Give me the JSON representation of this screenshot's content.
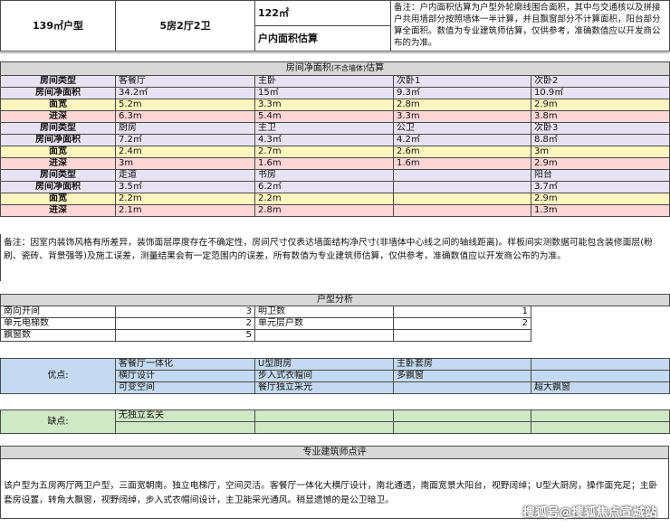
{
  "header": {
    "unit_type": "139㎡户型",
    "layout": "5房2厅2卫",
    "area": "122㎡",
    "area_label": "户内面积估算",
    "note": "备注：户内面积估算为户型外轮廓线围合面积，其中与交通核以及拼接户共用墙部分按照墙体一半计算，并且飘窗部分不计算面积，阳台部分算全面积。数值为专业建筑师估算，仅供参考，准确数值应以开发商公布的为准。"
  },
  "net_area": {
    "title": "房间净面积",
    "title_small": "(不含墙体)",
    "title_suffix": "估算",
    "labels": [
      "房间类型",
      "房间净面积",
      "面宽",
      "进深"
    ],
    "groups": [
      {
        "rooms": [
          "客餐厅",
          "主卧",
          "次卧1",
          "次卧2"
        ],
        "area": [
          "34.2㎡",
          "15㎡",
          "9.3㎡",
          "10.9㎡"
        ],
        "width": [
          "5.2m",
          "3.3m",
          "2.8m",
          "2.9m"
        ],
        "depth": [
          "6.3m",
          "5.4m",
          "3.3m",
          "3.8m"
        ]
      },
      {
        "rooms": [
          "厨房",
          "主卫",
          "公卫",
          "次卧3"
        ],
        "area": [
          "7.2㎡",
          "4.3㎡",
          "4.2㎡",
          "8.8㎡"
        ],
        "width": [
          "2.4m",
          "2.7m",
          "2.6m",
          "3m"
        ],
        "depth": [
          "3m",
          "1.6m",
          "1.6m",
          "2.9m"
        ]
      },
      {
        "rooms": [
          "走道",
          "书房",
          "",
          "阳台"
        ],
        "area": [
          "3.5㎡",
          "6.2㎡",
          "",
          "3.7㎡"
        ],
        "width": [
          "2.2m",
          "2.2m",
          "",
          "2.9m"
        ],
        "depth": [
          "2.1m",
          "2.8m",
          "",
          "1.3m"
        ]
      }
    ]
  },
  "note1": "备注：因室内装饰风格有所差异，装饰面层厚度存在不确定性，房间尺寸仅表达墙面结构净尺寸(非墙体中心线之间的轴线距离)。样板间实测数据可能包含装修面层(粉刷、瓷砖、背景强等)及施工误差，测量结果会有一定范围内的误差，所有数值为专业建筑师估算，仅供参考，准确数值应以开发商公布的为准。",
  "analysis": {
    "title": "户型分析",
    "rows": [
      {
        "left_label": "南向开间",
        "left_value": "3",
        "right_label": "明卫数",
        "right_value": "1"
      },
      {
        "left_label": "单元电梯数",
        "left_value": "2",
        "right_label": "单元层户数",
        "right_value": "2"
      },
      {
        "left_label": "飘窗数",
        "left_value": "5",
        "right_label": "",
        "right_value": ""
      }
    ]
  },
  "pros": {
    "label": "优点:",
    "rows": [
      [
        "客餐厅一体化",
        "U型厨房",
        "主卧套房",
        ""
      ],
      [
        "横厅设计",
        "步入式衣帽间",
        "多飘窗",
        ""
      ],
      [
        "可变空间",
        "餐厅独立采光",
        "",
        "超大飘窗"
      ]
    ]
  },
  "cons": {
    "label": "缺点:",
    "rows": [
      [
        "无独立玄关",
        "",
        "",
        ""
      ],
      [
        "",
        "",
        "",
        ""
      ]
    ]
  },
  "review": {
    "title": "专业建筑师点评",
    "text": "该户型为五房两厅两卫户型，三面宽朝南。独立电梯厅，空间灵活。客餐厅一体化大横厅设计，南北通透，南面宽景大阳台，视野阔绰；U型大厨房，操作面充足；主卧套房设置，转角大飘窗，视野阔绰，步入式衣帽间设计，主卫能采光通风。稍显遗憾的是公卫暗卫。"
  },
  "watermark": "搜狐号@搜狐焦点宣城站"
}
